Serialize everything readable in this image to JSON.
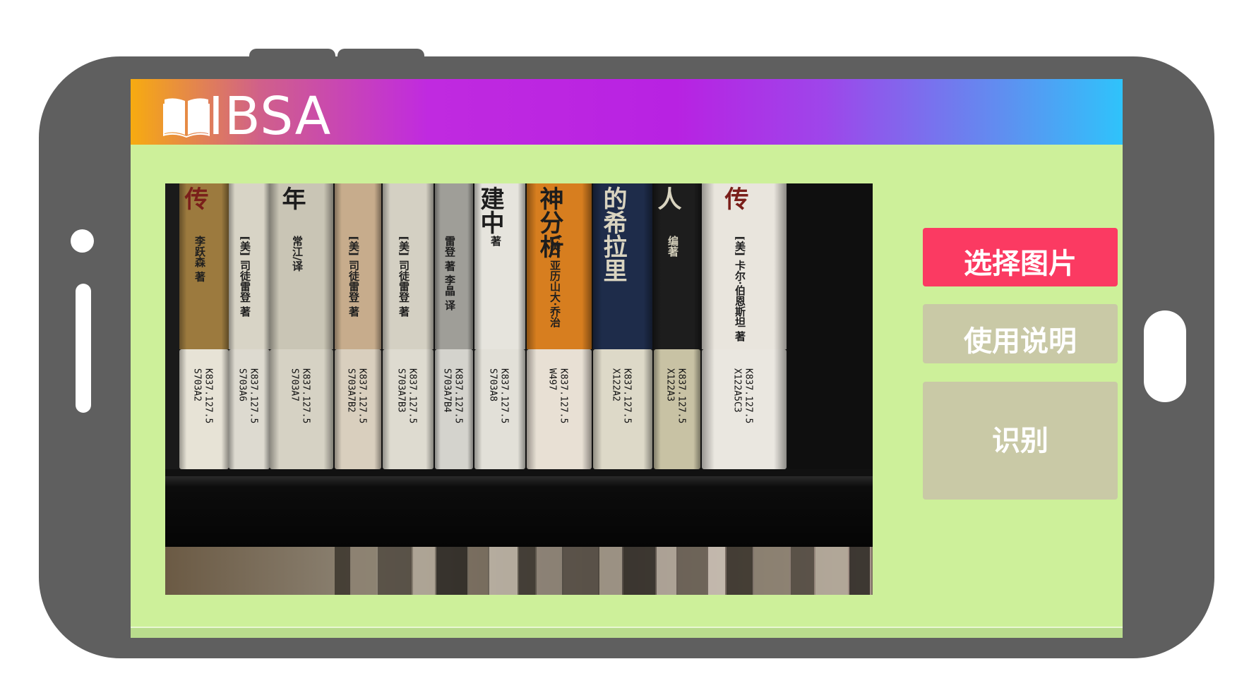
{
  "app": {
    "title": "IBSA",
    "logo_icon": "open-book-icon"
  },
  "buttons": {
    "select_image": "选择图片",
    "instructions": "使用说明",
    "recognize": "识别"
  },
  "photo": {
    "spines": [
      {
        "title": "传",
        "author": "李跃森 著",
        "call_number": "K837.127.5 S703A2"
      },
      {
        "title": "",
        "author": "[美] 司徒雷登 著",
        "call_number": "K837.127.5 S703A6"
      },
      {
        "title": "年",
        "author": "常江/译",
        "call_number": "K837.127.5 S703A7"
      },
      {
        "title": "",
        "author": "[美] 司徒雷登 著",
        "call_number": "K837.127.5 S703A7B2"
      },
      {
        "title": "",
        "author": "[美] 司徒雷登 著",
        "call_number": "K837.127.5 S703A7B3"
      },
      {
        "title": "",
        "author": "雷登 著 李晶 译",
        "call_number": "K837.127.5 S703A7B4"
      },
      {
        "title": "建中",
        "author": "著",
        "call_number": "K837.127.5 S703A8"
      },
      {
        "title": "神分析",
        "author": "[美] 亚历山大·乔治",
        "call_number": "K837.127.5 W497"
      },
      {
        "title": "的希拉里",
        "author": "",
        "call_number": "K837.127.5 X122A2"
      },
      {
        "title": "人",
        "author": "编著",
        "call_number": "K837.127.5 X122A3"
      },
      {
        "title": "传",
        "author": "[美] 卡尔·伯恩斯坦 著",
        "call_number": "K837.127.5 X122A5C3"
      }
    ]
  },
  "colors": {
    "frame": "#5f5f5f",
    "screen": "#cdf09a",
    "primary_button": "#fb3a62",
    "secondary_button": "#c9c9a6"
  }
}
